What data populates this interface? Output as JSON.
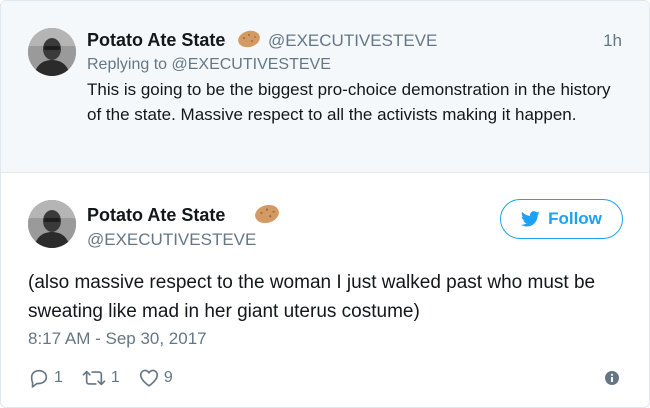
{
  "colors": {
    "accent": "#1da1f2",
    "muted": "#657786",
    "text": "#14171a",
    "context_bg": "#f5f8fa",
    "border": "#e1e8ed"
  },
  "parent_tweet": {
    "display_name": "Potato Ate State",
    "handle": "@EXECUTIVESTEVE",
    "time": "1h",
    "replying_to": "Replying to @EXECUTIVESTEVE",
    "text": "This is going to be the biggest pro-choice demonstration in the history of the state. Massive respect to all the activists making it happen."
  },
  "tweet": {
    "display_name": "Potato Ate State",
    "handle": "@EXECUTIVESTEVE",
    "follow_label": "Follow",
    "text": "(also massive respect to the woman I just walked past who must be sweating like mad in her giant uterus costume)",
    "timestamp": "8:17 AM - Sep 30, 2017",
    "actions": {
      "replies": "1",
      "retweets": "1",
      "likes": "9"
    }
  },
  "icons": {
    "name_emoji": "potato-icon",
    "follow": "twitter-bird-icon",
    "reply": "reply-icon",
    "retweet": "retweet-icon",
    "like": "heart-icon",
    "info": "info-icon"
  }
}
